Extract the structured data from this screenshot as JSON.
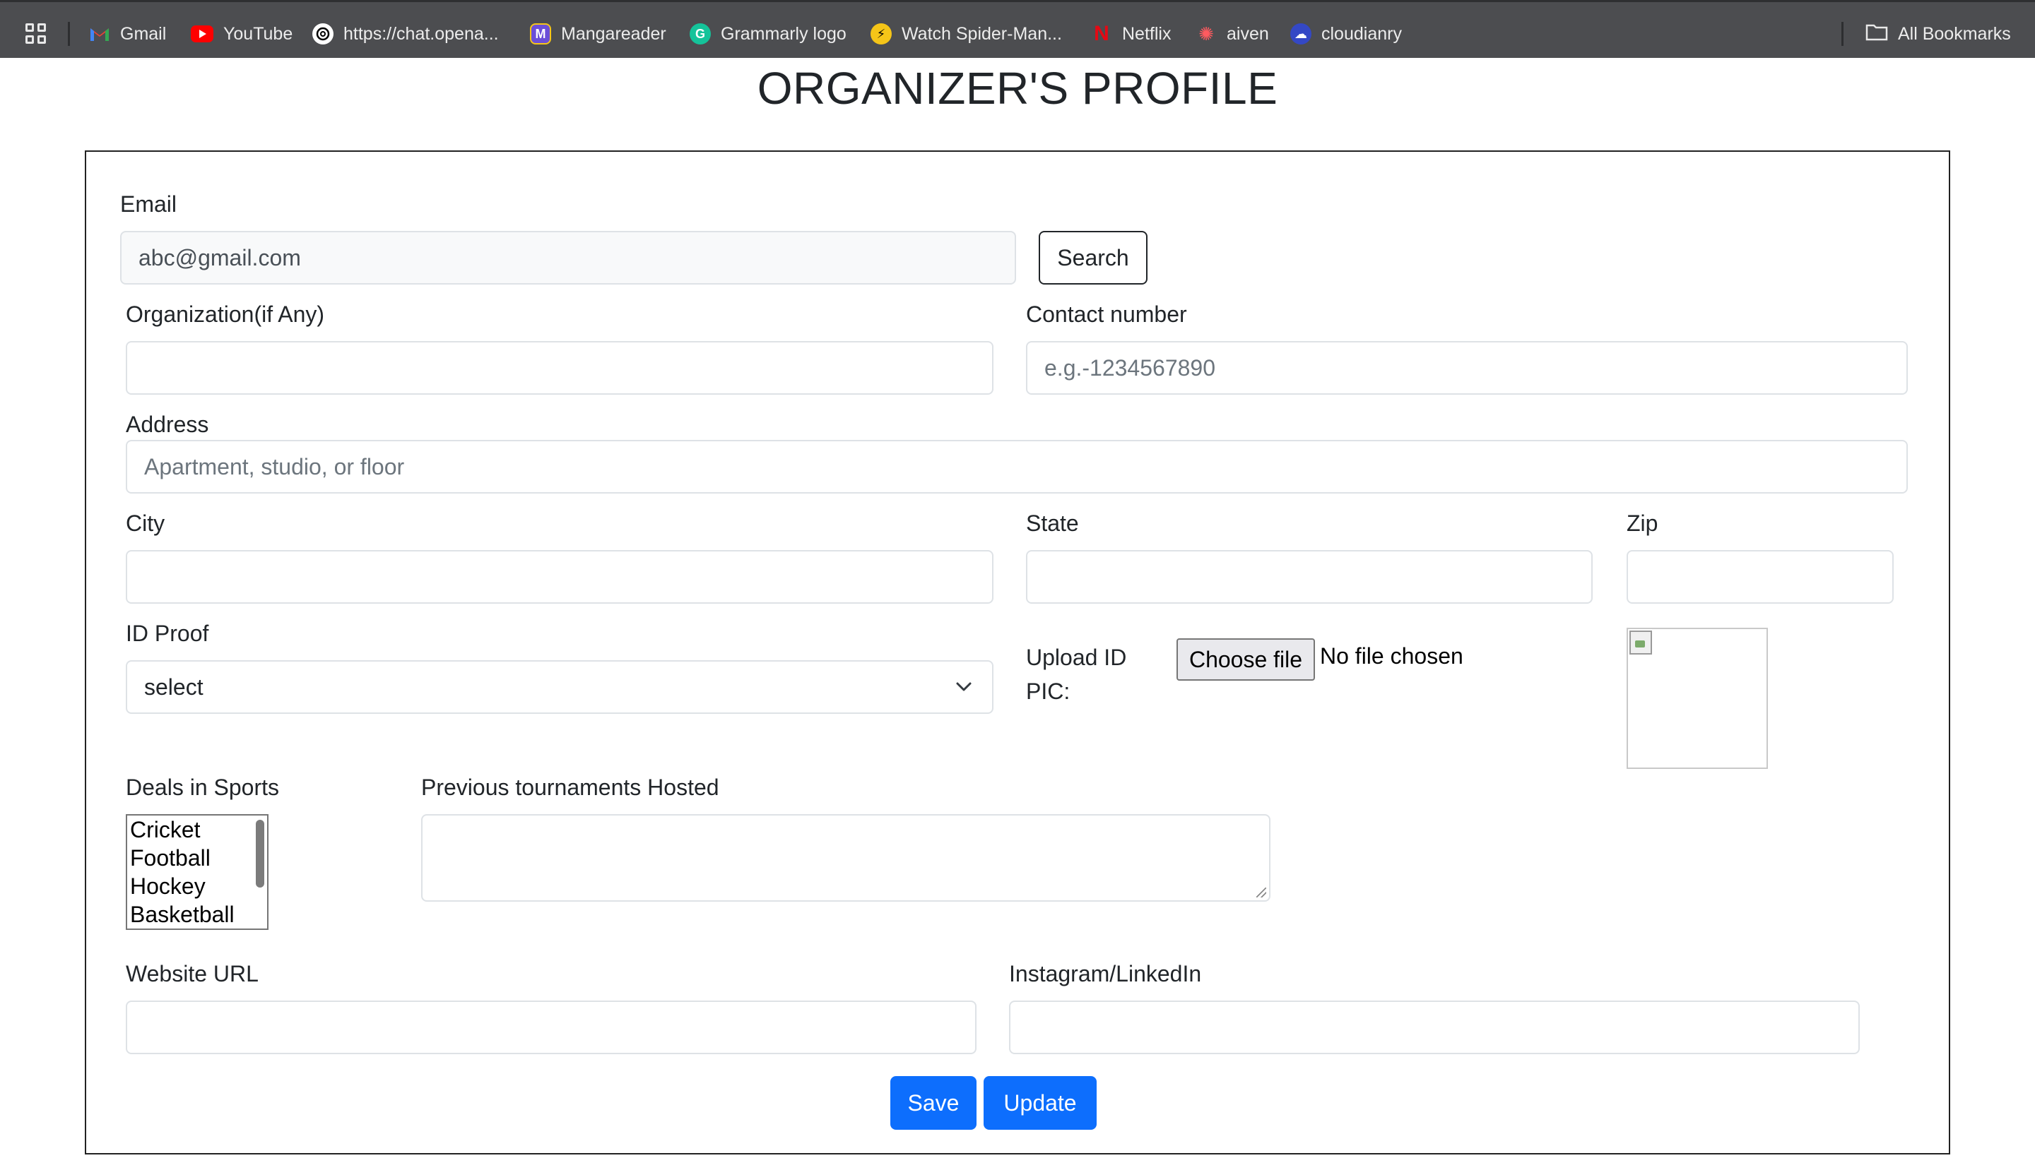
{
  "bookmarks": [
    {
      "label": "Gmail",
      "icon": "gmail-icon",
      "color": "#ea4335"
    },
    {
      "label": "YouTube",
      "icon": "youtube-icon",
      "color": "#ff0000"
    },
    {
      "label": "https://chat.opena...",
      "icon": "openai-icon",
      "color": "#ffffff"
    },
    {
      "label": "Mangareader",
      "icon": "mangareader-icon",
      "color": "#6b4fd8"
    },
    {
      "label": "Grammarly logo",
      "icon": "grammarly-icon",
      "color": "#15c39a"
    },
    {
      "label": "Watch Spider-Man...",
      "icon": "spiderman-icon",
      "color": "#f5c518"
    },
    {
      "label": "Netflix",
      "icon": "netflix-icon",
      "color": "#e50914"
    },
    {
      "label": "aiven",
      "icon": "aiven-icon",
      "color": "#ff5a5f"
    },
    {
      "label": "cloudianry",
      "icon": "cloudinary-icon",
      "color": "#3448c5"
    }
  ],
  "all_bookmarks_label": "All Bookmarks",
  "page": {
    "title": "ORGANIZER'S PROFILE"
  },
  "form": {
    "email": {
      "label": "Email",
      "value": "abc@gmail.com"
    },
    "search_label": "Search",
    "organization": {
      "label": "Organization(if Any)",
      "value": ""
    },
    "contact": {
      "label": "Contact number",
      "placeholder": "e.g.-1234567890"
    },
    "address": {
      "label": "Address",
      "placeholder": "Apartment, studio, or floor"
    },
    "city": {
      "label": "City",
      "value": ""
    },
    "state": {
      "label": "State",
      "value": ""
    },
    "zip": {
      "label": "Zip",
      "value": ""
    },
    "id_proof": {
      "label": "ID Proof",
      "selected": "select"
    },
    "upload": {
      "label": "Upload ID PIC:",
      "button": "Choose file",
      "status": "No file chosen"
    },
    "sports": {
      "label": "Deals in Sports",
      "options": [
        "Cricket",
        "Football",
        "Hockey",
        "Basketball"
      ]
    },
    "tournaments": {
      "label": "Previous tournaments Hosted",
      "value": ""
    },
    "website": {
      "label": "Website URL",
      "value": ""
    },
    "social": {
      "label": "Instagram/LinkedIn",
      "value": ""
    },
    "save_label": "Save",
    "update_label": "Update"
  },
  "colors": {
    "primary": "#0d6efd",
    "bookmarks_bar": "#4c4d50"
  }
}
